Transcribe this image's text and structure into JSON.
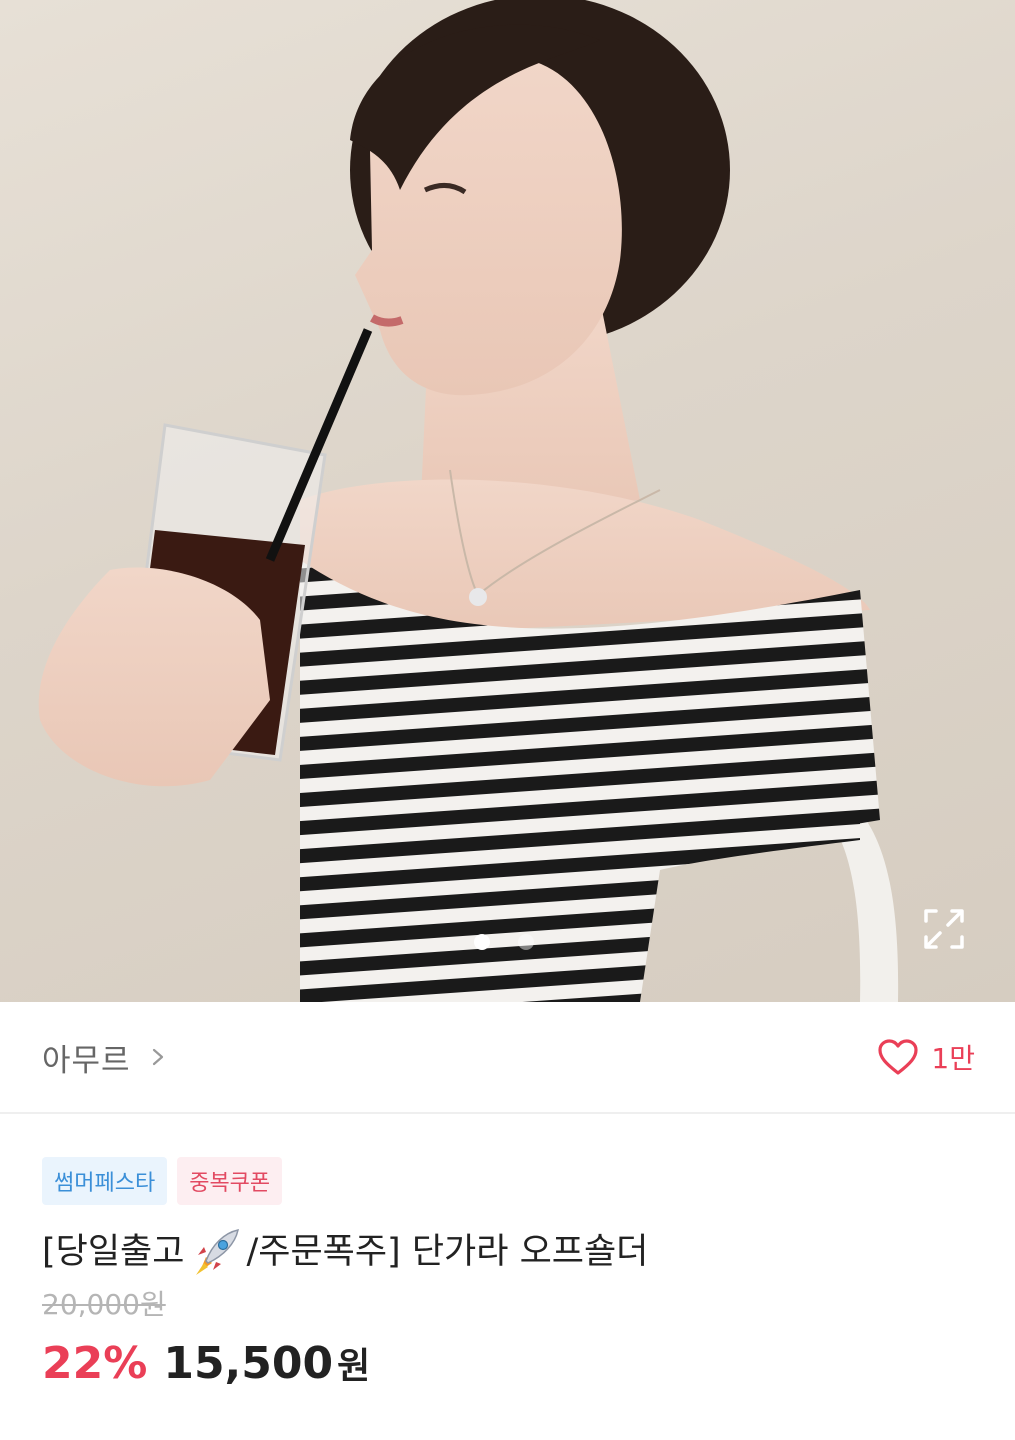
{
  "product_image": {
    "alt": "",
    "slides_total": 2,
    "active_slide": 1
  },
  "icons": {
    "expand": "expand-arrows-icon",
    "chevron": "chevron-right-icon",
    "heart": "heart-outline-icon",
    "rocket": "rocket-icon"
  },
  "store": {
    "name": "아무르",
    "likes": "1만"
  },
  "badges": [
    {
      "label": "썸머페스타",
      "color": "#3b8fd8"
    },
    {
      "label": "중복쿠폰",
      "color": "#e24a62"
    }
  ],
  "product": {
    "title_prefix": "[당일출고",
    "title_suffix": "/주문폭주] 단가라 오프숄더",
    "original_price": "20,000원",
    "discount": "22%",
    "price": "15,500",
    "currency": "원"
  },
  "colors": {
    "accent": "#ea3f57",
    "badge_blue": "#3b8fd8",
    "badge_red": "#e24a62"
  }
}
